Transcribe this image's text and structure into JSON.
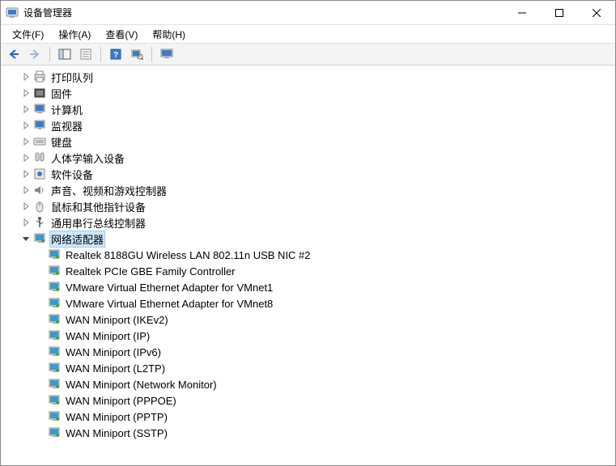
{
  "window": {
    "title": "设备管理器"
  },
  "menu": {
    "file": "文件(F)",
    "action": "操作(A)",
    "view": "查看(V)",
    "help": "帮助(H)"
  },
  "toolbar_icons": {
    "back": "back-icon",
    "forward": "forward-icon",
    "properties": "properties-icon",
    "list": "list-icon",
    "help": "help-icon",
    "scan": "scan-icon",
    "monitor": "monitor-icon"
  },
  "tree": {
    "nodes": [
      {
        "label": "打印队列",
        "icon": "printer",
        "expanded": false
      },
      {
        "label": "固件",
        "icon": "firmware",
        "expanded": false
      },
      {
        "label": "计算机",
        "icon": "computer",
        "expanded": false
      },
      {
        "label": "监视器",
        "icon": "monitor",
        "expanded": false
      },
      {
        "label": "键盘",
        "icon": "keyboard",
        "expanded": false
      },
      {
        "label": "人体学输入设备",
        "icon": "hid",
        "expanded": false
      },
      {
        "label": "软件设备",
        "icon": "software",
        "expanded": false
      },
      {
        "label": "声音、视频和游戏控制器",
        "icon": "sound",
        "expanded": false
      },
      {
        "label": "鼠标和其他指针设备",
        "icon": "mouse",
        "expanded": false
      },
      {
        "label": "通用串行总线控制器",
        "icon": "usb",
        "expanded": false
      },
      {
        "label": "网络适配器",
        "icon": "network",
        "expanded": true,
        "selected": true,
        "children": [
          {
            "label": "Realtek 8188GU Wireless LAN 802.11n USB NIC #2"
          },
          {
            "label": "Realtek PCIe GBE Family Controller"
          },
          {
            "label": "VMware Virtual Ethernet Adapter for VMnet1"
          },
          {
            "label": "VMware Virtual Ethernet Adapter for VMnet8"
          },
          {
            "label": "WAN Miniport (IKEv2)"
          },
          {
            "label": "WAN Miniport (IP)"
          },
          {
            "label": "WAN Miniport (IPv6)"
          },
          {
            "label": "WAN Miniport (L2TP)"
          },
          {
            "label": "WAN Miniport (Network Monitor)"
          },
          {
            "label": "WAN Miniport (PPPOE)"
          },
          {
            "label": "WAN Miniport (PPTP)"
          },
          {
            "label": "WAN Miniport (SSTP)"
          }
        ]
      }
    ]
  }
}
